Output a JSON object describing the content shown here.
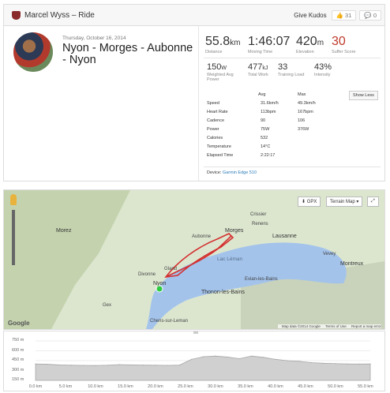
{
  "header": {
    "title": "Marcel Wyss – Ride",
    "kudos_label": "Give Kudos",
    "kudos_count": "31",
    "comments_count": "0"
  },
  "activity": {
    "date": "Thursday, October 16, 2014",
    "title": "Nyon - Morges - Aubonne - Nyon"
  },
  "stats_primary": [
    {
      "value": "55.8",
      "unit": "km",
      "label": "Distance"
    },
    {
      "value": "1:46:07",
      "unit": "",
      "label": "Moving Time"
    },
    {
      "value": "420",
      "unit": "m",
      "label": "Elevation"
    },
    {
      "value": "30",
      "unit": "",
      "label": "Suffer Score"
    }
  ],
  "stats_secondary": [
    {
      "value": "150",
      "unit": "W",
      "label": "Weighted Avg Power"
    },
    {
      "value": "477",
      "unit": "kJ",
      "label": "Total Work"
    },
    {
      "value": "33",
      "unit": "",
      "label": "Training Load"
    },
    {
      "value": "43%",
      "unit": "",
      "label": "Intensity"
    }
  ],
  "show_less_label": "Show Less",
  "table": {
    "headers": {
      "avg": "Avg",
      "max": "Max"
    },
    "rows": [
      {
        "label": "Speed",
        "avg": "31.6km/h",
        "max": "49.3km/h"
      },
      {
        "label": "Heart Rate",
        "avg": "113bpm",
        "max": "167bpm"
      },
      {
        "label": "Cadence",
        "avg": "90",
        "max": "106"
      },
      {
        "label": "Power",
        "avg": "75W",
        "max": "376W"
      },
      {
        "label": "Calories",
        "avg": "532",
        "max": ""
      },
      {
        "label": "Temperature",
        "avg": "14°C",
        "max": ""
      },
      {
        "label": "Elapsed Time",
        "avg": "2:22:17",
        "max": ""
      }
    ]
  },
  "device": {
    "label": "Device:",
    "name": "Garmin Edge 510"
  },
  "map": {
    "gpx_label": "GPX",
    "map_type_label": "Terrain Map",
    "attribution": "Map data ©2014 Google",
    "terms_label": "Terms of Use",
    "report_label": "Report a map error",
    "logo_text": "Google",
    "labels": [
      "Morez",
      "Nyon",
      "Gland",
      "Morges",
      "Lausanne",
      "Montreux",
      "Thonon-les-Bains",
      "Evian-les-Bains",
      "Lac Léman",
      "Aubonne",
      "Gex",
      "Divonne",
      "Chens-sur-Leman",
      "Crissier",
      "Renens",
      "Vevey"
    ]
  },
  "chart_data": {
    "type": "area",
    "title": "",
    "ylabel": "",
    "xlabel": "",
    "yticks": [
      "750 m",
      "600 m",
      "450 m",
      "300 m",
      "150 m"
    ],
    "xticks": [
      "0.0 km",
      "5.0 km",
      "10.0 km",
      "15.0 km",
      "20.0 km",
      "25.0 km",
      "30.0 km",
      "35.0 km",
      "40.0 km",
      "45.0 km",
      "50.0 km",
      "55.0 km"
    ],
    "ylim": [
      150,
      750
    ],
    "xlim": [
      0,
      55.8
    ],
    "x": [
      0,
      2,
      4,
      6,
      8,
      10,
      12,
      14,
      16,
      18,
      20,
      22,
      24,
      26,
      28,
      30,
      32,
      34,
      36,
      38,
      40,
      42,
      44,
      46,
      48,
      50,
      52,
      54,
      55.8
    ],
    "y": [
      400,
      395,
      385,
      380,
      378,
      376,
      380,
      390,
      385,
      382,
      380,
      378,
      382,
      470,
      510,
      520,
      505,
      480,
      520,
      500,
      470,
      450,
      440,
      420,
      410,
      405,
      400,
      398,
      400
    ],
    "colors": {
      "fill": "#d0d0d0",
      "line": "#a8a8a8"
    }
  }
}
